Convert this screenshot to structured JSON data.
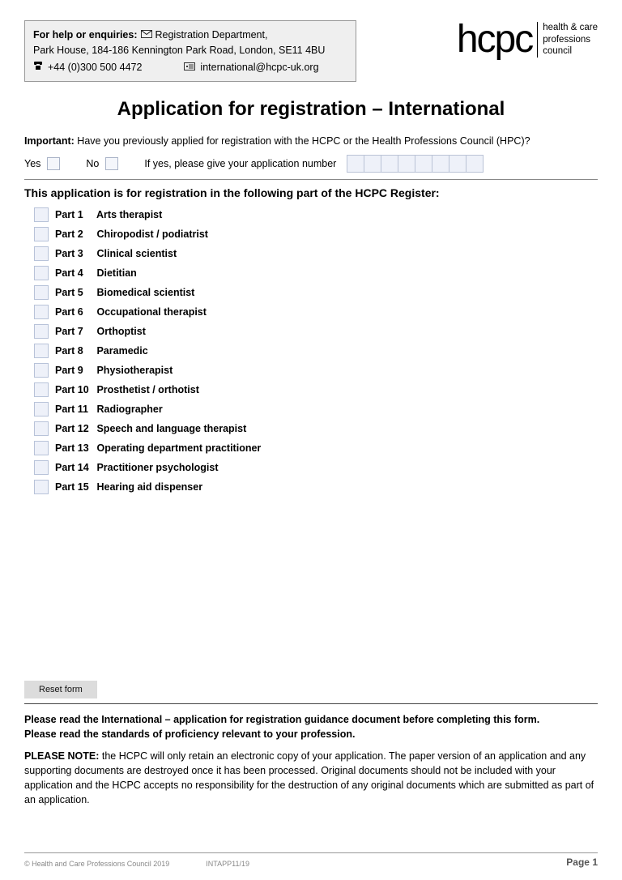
{
  "helpbox": {
    "label": "For help or enquiries:",
    "dept": "Registration Department,",
    "address": "Park House, 184-186 Kennington Park Road, London, SE11 4BU",
    "phone": "+44 (0)300 500 4472",
    "email": "international@hcpc-uk.org"
  },
  "logo": {
    "text": "hcpc",
    "line1": "health & care",
    "line2": "professions",
    "line3": "council"
  },
  "title": "Application for registration – International",
  "important": {
    "label": "Important:",
    "text": " Have you previously applied for registration with the HCPC or the Health Professions Council (HPC)?"
  },
  "yes": "Yes",
  "no": "No",
  "appnum_label": "If yes, please give your application number",
  "section_heading": "This application is for registration in the following part of the HCPC Register:",
  "parts": [
    {
      "num": "Part 1",
      "label": "Arts therapist"
    },
    {
      "num": "Part 2",
      "label": "Chiropodist / podiatrist"
    },
    {
      "num": "Part 3",
      "label": "Clinical scientist"
    },
    {
      "num": "Part 4",
      "label": "Dietitian"
    },
    {
      "num": "Part 5",
      "label": "Biomedical scientist"
    },
    {
      "num": "Part 6",
      "label": "Occupational therapist"
    },
    {
      "num": "Part 7",
      "label": "Orthoptist"
    },
    {
      "num": "Part 8",
      "label": "Paramedic"
    },
    {
      "num": "Part 9",
      "label": "Physiotherapist"
    },
    {
      "num": "Part 10",
      "label": "Prosthetist / orthotist"
    },
    {
      "num": "Part 11",
      "label": "Radiographer"
    },
    {
      "num": "Part 12",
      "label": "Speech and language therapist"
    },
    {
      "num": "Part 13",
      "label": "Operating department practitioner"
    },
    {
      "num": "Part 14",
      "label": "Practitioner psychologist"
    },
    {
      "num": "Part 15",
      "label": "Hearing aid dispenser"
    }
  ],
  "reset_label": "Reset form",
  "readnote_line1": "Please read the International – application for registration guidance document before completing this form.",
  "readnote_line2": "Please read the standards of proficiency relevant to your profession.",
  "pleasenote_label": "PLEASE NOTE:",
  "pleasenote_text": " the HCPC will only retain an electronic copy of your application. The paper version of an application and any supporting documents are destroyed once it has been processed. Original documents should not be included with your application and the HCPC accepts no responsibility for the destruction of any original documents which are submitted as part of an application.",
  "footer": {
    "copyright": "© Health and Care Professions Council 2019",
    "code": "INTAPP11/19",
    "page": "Page 1"
  }
}
